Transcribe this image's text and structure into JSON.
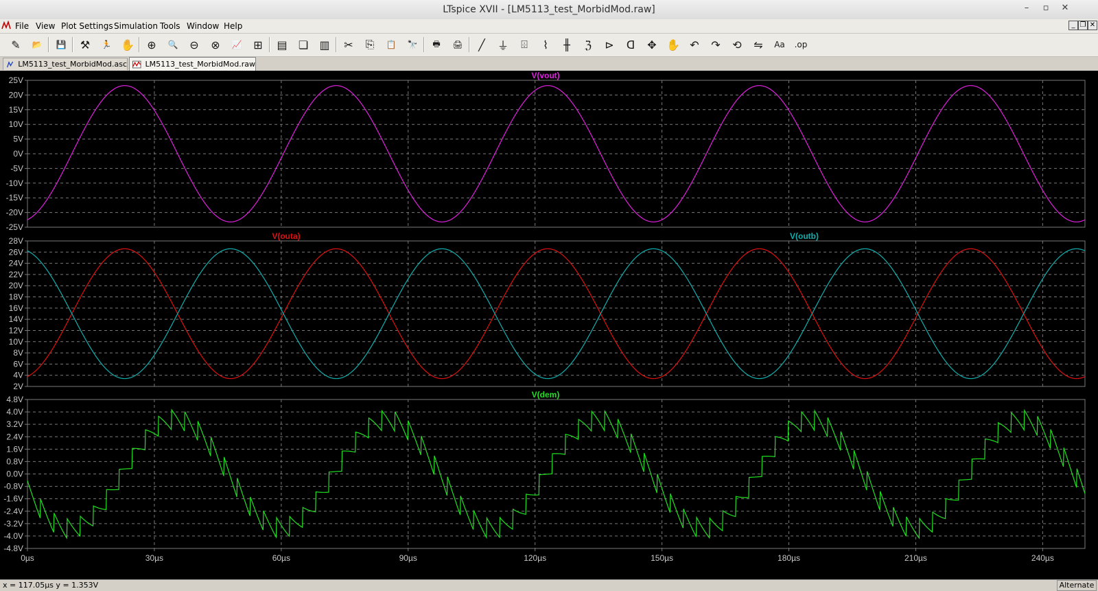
{
  "window": {
    "title": "LTspice XVII - [LM5113_test_MorbidMod.raw]",
    "controls": {
      "minimize": "–",
      "restore": "▫",
      "close": "✕"
    }
  },
  "menubar": {
    "items": [
      "File",
      "View",
      "Plot Settings",
      "Simulation",
      "Tools",
      "Window",
      "Help"
    ],
    "mdi_controls": [
      "_",
      "❐",
      "✕"
    ]
  },
  "toolbar": {
    "icons": [
      {
        "name": "new-schematic-icon",
        "glyph": "✎"
      },
      {
        "name": "open-icon",
        "glyph": "📂"
      },
      {
        "name": "save-icon",
        "glyph": "💾"
      },
      {
        "name": "control-panel-icon",
        "glyph": "⚒"
      },
      {
        "name": "run-icon",
        "glyph": "🏃"
      },
      {
        "name": "halt-icon",
        "glyph": "✋"
      },
      {
        "name": "zoom-in-icon",
        "glyph": "⊕"
      },
      {
        "name": "zoom-pan-icon",
        "glyph": "🔍"
      },
      {
        "name": "zoom-out-icon",
        "glyph": "⊖"
      },
      {
        "name": "zoom-cancel-icon",
        "glyph": "⊗"
      },
      {
        "name": "autorange-icon",
        "glyph": "📈"
      },
      {
        "name": "fit-icon",
        "glyph": "⊞"
      },
      {
        "name": "tile-horizontal-icon",
        "glyph": "▤"
      },
      {
        "name": "cascade-icon",
        "glyph": "❏"
      },
      {
        "name": "tile-vertical-icon",
        "glyph": "▥"
      },
      {
        "name": "cut-icon",
        "glyph": "✂"
      },
      {
        "name": "copy-icon",
        "glyph": "⎘"
      },
      {
        "name": "paste-icon",
        "glyph": "📋"
      },
      {
        "name": "find-icon",
        "glyph": "🔭"
      },
      {
        "name": "print-icon",
        "glyph": "🖶"
      },
      {
        "name": "print-preview-icon",
        "glyph": "🖨"
      },
      {
        "name": "draw-wire-icon",
        "glyph": "╱"
      },
      {
        "name": "ground-icon",
        "glyph": "⏚"
      },
      {
        "name": "label-net-icon",
        "glyph": "⌹"
      },
      {
        "name": "resistor-icon",
        "glyph": "⌇"
      },
      {
        "name": "capacitor-icon",
        "glyph": "╫"
      },
      {
        "name": "inductor-icon",
        "glyph": "ℨ"
      },
      {
        "name": "diode-icon",
        "glyph": "⊳"
      },
      {
        "name": "component-icon",
        "glyph": "ᗡ"
      },
      {
        "name": "move-icon",
        "glyph": "✥"
      },
      {
        "name": "drag-icon",
        "glyph": "✋"
      },
      {
        "name": "undo-icon",
        "glyph": "↶"
      },
      {
        "name": "redo-icon",
        "glyph": "↷"
      },
      {
        "name": "rotate-icon",
        "glyph": "⟲"
      },
      {
        "name": "mirror-icon",
        "glyph": "⇋"
      },
      {
        "name": "text-icon",
        "glyph": "Aa"
      },
      {
        "name": "spice-directive-icon",
        "glyph": ".op"
      }
    ]
  },
  "tabs": [
    {
      "label": "LM5113_test_MorbidMod.asc",
      "active": false
    },
    {
      "label": "LM5113_test_MorbidMod.raw",
      "active": true
    }
  ],
  "colors": {
    "background": "#000000",
    "grid": "#7a7a7a",
    "axis_text": "#c8c8c8",
    "vout": "#e020e0",
    "outa": "#e01010",
    "outb": "#10b0b0",
    "dem": "#20e020"
  },
  "chart_data": [
    {
      "type": "line",
      "title": "",
      "x_unit": "µs",
      "xlim": [
        0,
        250
      ],
      "x_ticks": [
        "0µs",
        "30µs",
        "60µs",
        "90µs",
        "120µs",
        "150µs",
        "180µs",
        "210µs",
        "240µs"
      ],
      "ylim": [
        -25,
        25
      ],
      "y_ticks": [
        "25V",
        "20V",
        "15V",
        "10V",
        "5V",
        "0V",
        "-5V",
        "-10V",
        "-15V",
        "-20V",
        "-25V"
      ],
      "series": [
        {
          "name": "V(vout)",
          "color": "#e020e0",
          "waveform": "sine",
          "amplitude": 23.2,
          "offset": 0,
          "period_us": 50,
          "peak_at_us": 23
        }
      ]
    },
    {
      "type": "line",
      "title": "",
      "x_unit": "µs",
      "xlim": [
        0,
        250
      ],
      "ylim": [
        2,
        28
      ],
      "y_ticks": [
        "28V",
        "26V",
        "24V",
        "22V",
        "20V",
        "18V",
        "16V",
        "14V",
        "12V",
        "10V",
        "8V",
        "6V",
        "4V",
        "2V"
      ],
      "series": [
        {
          "name": "V(outa)",
          "color": "#e01010",
          "waveform": "sine",
          "amplitude": 11.6,
          "offset": 15,
          "period_us": 50,
          "peak_at_us": 23
        },
        {
          "name": "V(outb)",
          "color": "#10b0b0",
          "waveform": "sine",
          "amplitude": 11.6,
          "offset": 15,
          "period_us": 50,
          "peak_at_us": 48
        }
      ]
    },
    {
      "type": "line",
      "title": "",
      "x_unit": "µs",
      "xlim": [
        0,
        250
      ],
      "ylim": [
        -4.8,
        4.8
      ],
      "y_ticks": [
        "4.8V",
        "4.0V",
        "3.2V",
        "2.4V",
        "1.6V",
        "0.8V",
        "0.0V",
        "-0.8V",
        "-1.6V",
        "-2.4V",
        "-3.2V",
        "-4.0V",
        "-4.8V"
      ],
      "series": [
        {
          "name": "V(dem)",
          "color": "#20e020",
          "waveform": "sine-sawtooth",
          "amplitude": 3.5,
          "offset": 0,
          "period_us": 50,
          "peak_at_us": 35,
          "ripple_amplitude": 1.3,
          "ripple_period_us": 3.1
        }
      ]
    }
  ],
  "status": {
    "cursor": "x = 117.05µs    y = 1.353V",
    "mode": "Alternate"
  }
}
